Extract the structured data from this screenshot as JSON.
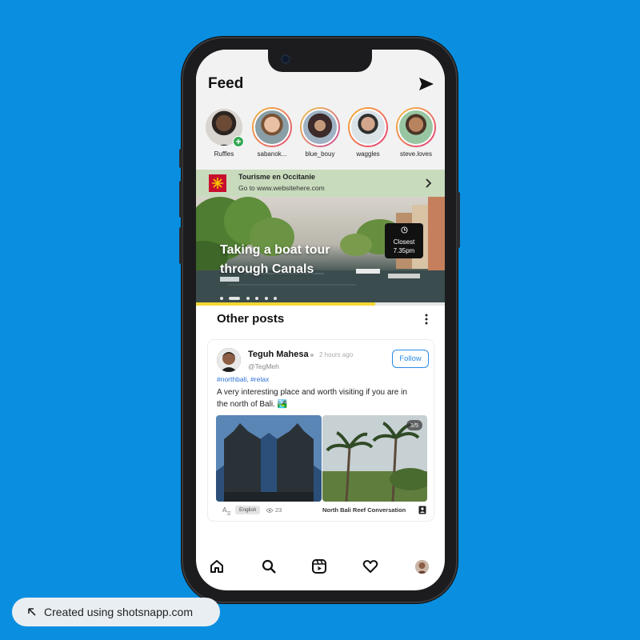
{
  "feed": {
    "title": "Feed"
  },
  "stories": [
    {
      "name": "Ruffles",
      "has_add": true
    },
    {
      "name": "sabanok..."
    },
    {
      "name": "blue_bouy"
    },
    {
      "name": "waggles"
    },
    {
      "name": "steve.loves"
    }
  ],
  "ad": {
    "name": "Tourisme en Occitanie",
    "url": "Go to www.websitehere.com"
  },
  "hero": {
    "title": "Taking a boat tour through Canals",
    "closest_label": "Closest",
    "closest_time": "7.35pm",
    "progress": 0.72
  },
  "other_posts": {
    "title": "Other posts"
  },
  "post": {
    "author": "Teguh Mahesa",
    "time": "2 hours ago",
    "handle": "@TegMeh",
    "follow_label": "Follow",
    "tags": "#northbali, #relax",
    "text": "A very interesting place and worth visiting if you are in the north of Bali. 🏞️",
    "image_counter": "3/5",
    "language": "English",
    "views": "23",
    "caption": "North Bali Reef Conversation"
  },
  "footer": {
    "credit": "Created using shotsnapp.com"
  },
  "colors": {
    "background": "#0a8fe0",
    "accent": "#2b8ae5",
    "progress": "#f5d633",
    "ad_bg": "#c8dbbd"
  }
}
